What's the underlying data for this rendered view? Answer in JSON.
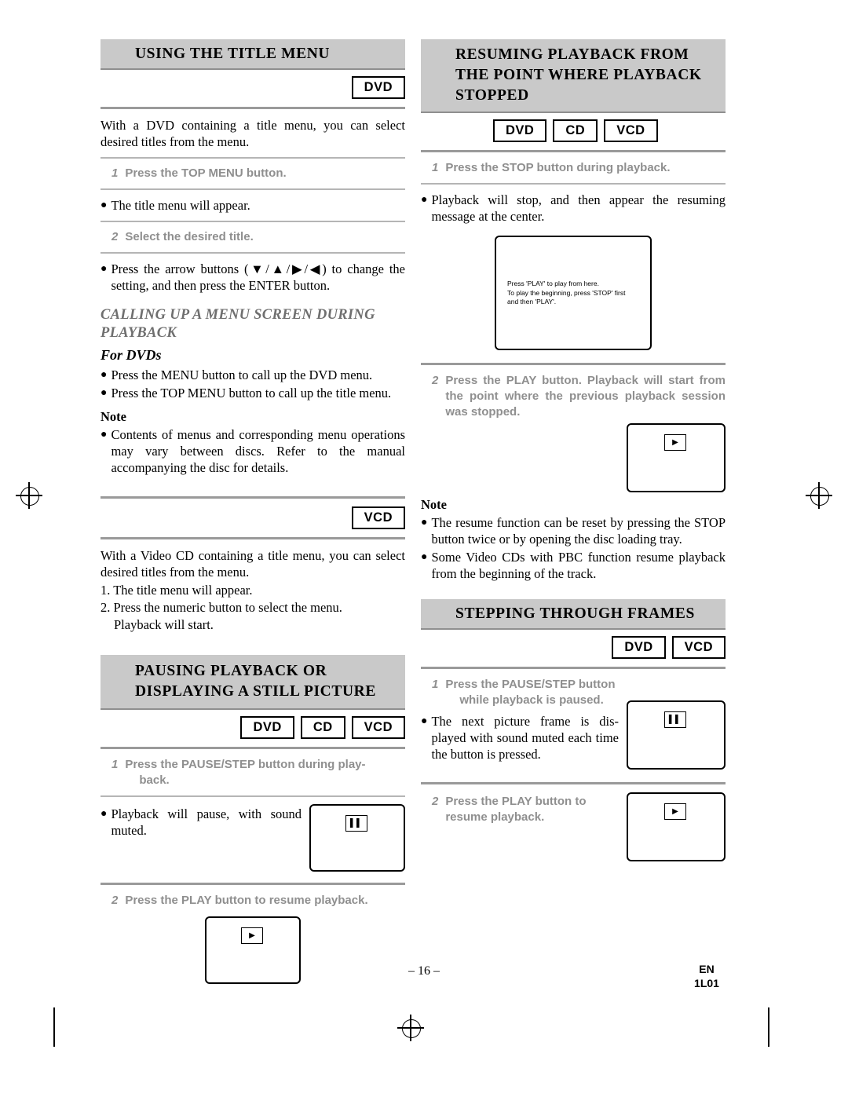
{
  "left_column": {
    "section1": {
      "title": "USING THE TITLE MENU",
      "tags": [
        "DVD"
      ],
      "intro": "With a DVD containing a title menu, you can select desired titles from the menu.",
      "steps": [
        {
          "num": "1",
          "text": "Press the TOP MENU button."
        },
        {
          "num": "2",
          "text": "Select the desired title."
        }
      ],
      "bullet1": "The title menu will appear.",
      "bullet2": "Press the arrow buttons (▼/▲/▶/◀) to change the setting, and then press the ENTER button.",
      "subhead": "CALLING UP A MENU SCREEN DURING PLAYBACK",
      "subhead2": "For DVDs",
      "bullet3": "Press the MENU button to call up the DVD menu.",
      "bullet4": "Press the TOP MENU button to call up the title menu.",
      "note_label": "Note",
      "note_bullet": "Contents of menus and corresponding menu operations may vary between discs. Refer to the manual accompanying the disc for details.",
      "vcd_tag": "VCD",
      "vcd_intro": "With a Video CD containing a title menu, you can select desired titles from the menu.",
      "vcd_list": [
        "1. The title menu will appear.",
        "2. Press the numeric button to select the menu.",
        "Playback will start."
      ]
    },
    "section2": {
      "title": "PAUSING PLAYBACK OR DISPLAYING A STILL PICTURE",
      "tags": [
        "DVD",
        "CD",
        "VCD"
      ],
      "step1_num": "1",
      "step1_text": "Press the PAUSE/STEP button during play-",
      "step1_text2": "back.",
      "bullet1": "Playback will pause, with sound muted.",
      "step2_num": "2",
      "step2_text": "Press the PLAY button to resume playback.",
      "screen1_icon": "pause-icon",
      "screen2_icon": "play-icon"
    }
  },
  "right_column": {
    "section1": {
      "title": "RESUMING PLAYBACK FROM THE POINT WHERE PLAYBACK STOPPED",
      "tags": [
        "DVD",
        "CD",
        "VCD"
      ],
      "step1_num": "1",
      "step1_text": "Press the STOP button during playback.",
      "bullet1": "Playback will stop, and then appear the resuming message at the center.",
      "screen_message": [
        "Press 'PLAY' to play from here.",
        "To play the beginning, press 'STOP' first",
        "and then 'PLAY'."
      ],
      "step2_num": "2",
      "step2_text": "Press the PLAY button. Playback will start from the point where the previous playback session was stopped.",
      "screen2_icon": "play-icon",
      "note_label": "Note",
      "note_bullet1": "The resume function can be reset by pressing the STOP button twice or by opening the disc loading tray.",
      "note_bullet2": "Some Video CDs with PBC function resume playback from the beginning of the track."
    },
    "section2": {
      "title": "STEPPING THROUGH FRAMES",
      "tags": [
        "DVD",
        "VCD"
      ],
      "step1_num": "1",
      "step1_text": "Press the PAUSE/STEP button",
      "step1_text2": "while playback is paused.",
      "bullet1": "The next picture frame is dis-played with sound muted each time the button is pressed.",
      "screen1_icon": "pause-icon",
      "step2_num": "2",
      "step2_text": "Press the PLAY button to",
      "step2_text2": "resume playback.",
      "screen2_icon": "play-icon"
    }
  },
  "footer": {
    "page_number": "– 16 –",
    "lang": "EN",
    "code": "1L01"
  },
  "icons": {
    "pause": "❙❙",
    "play": "▶",
    "bullet_dot": "●"
  }
}
